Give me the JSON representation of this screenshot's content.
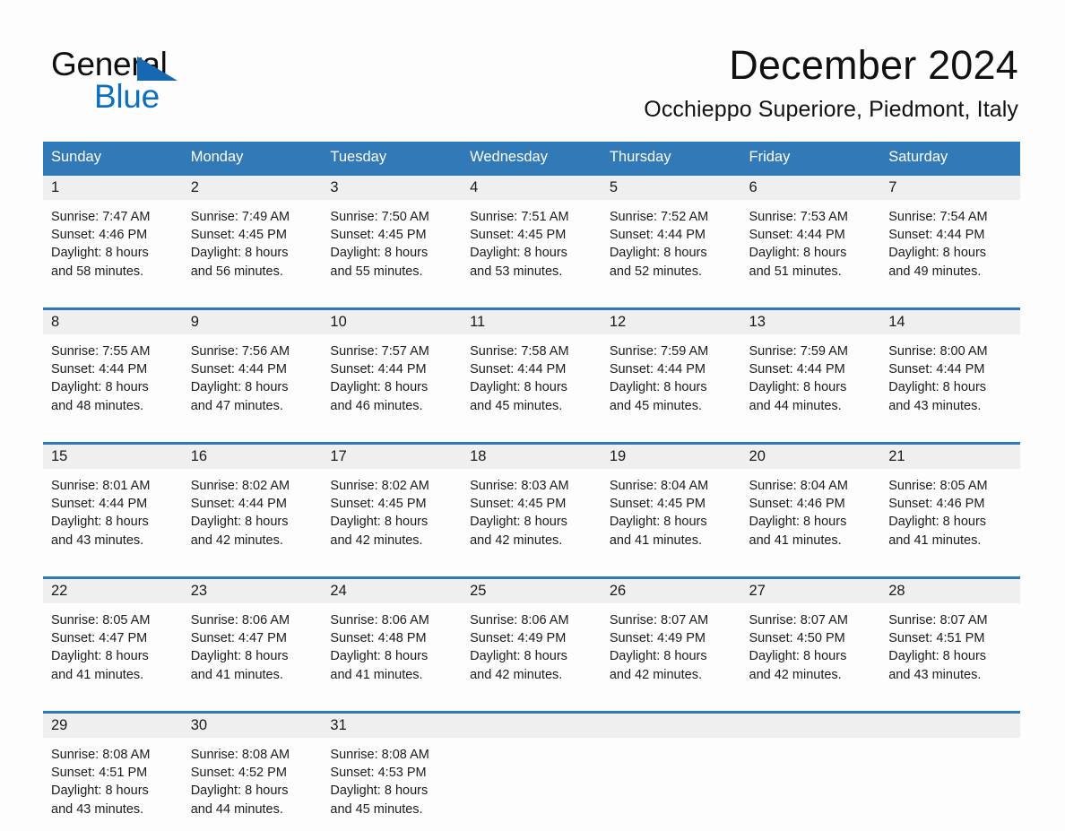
{
  "brand": {
    "name_part1": "General",
    "name_part2": "Blue",
    "logo_icon": "triangle-flag-icon"
  },
  "header": {
    "title": "December 2024",
    "location": "Occhieppo Superiore, Piedmont, Italy"
  },
  "colors": {
    "header_blue": "#3279b7",
    "row_rule_blue": "#2f79b8",
    "daynum_band": "#efefef",
    "brand_blue": "#0d6fc0",
    "page_background": "#fdfdfd"
  },
  "calendar": {
    "weekday_headers": [
      "Sunday",
      "Monday",
      "Tuesday",
      "Wednesday",
      "Thursday",
      "Friday",
      "Saturday"
    ],
    "weeks": [
      [
        {
          "day": "1",
          "sunrise": "Sunrise: 7:47 AM",
          "sunset": "Sunset: 4:46 PM",
          "daylight_line1": "Daylight: 8 hours",
          "daylight_line2": "and 58 minutes."
        },
        {
          "day": "2",
          "sunrise": "Sunrise: 7:49 AM",
          "sunset": "Sunset: 4:45 PM",
          "daylight_line1": "Daylight: 8 hours",
          "daylight_line2": "and 56 minutes."
        },
        {
          "day": "3",
          "sunrise": "Sunrise: 7:50 AM",
          "sunset": "Sunset: 4:45 PM",
          "daylight_line1": "Daylight: 8 hours",
          "daylight_line2": "and 55 minutes."
        },
        {
          "day": "4",
          "sunrise": "Sunrise: 7:51 AM",
          "sunset": "Sunset: 4:45 PM",
          "daylight_line1": "Daylight: 8 hours",
          "daylight_line2": "and 53 minutes."
        },
        {
          "day": "5",
          "sunrise": "Sunrise: 7:52 AM",
          "sunset": "Sunset: 4:44 PM",
          "daylight_line1": "Daylight: 8 hours",
          "daylight_line2": "and 52 minutes."
        },
        {
          "day": "6",
          "sunrise": "Sunrise: 7:53 AM",
          "sunset": "Sunset: 4:44 PM",
          "daylight_line1": "Daylight: 8 hours",
          "daylight_line2": "and 51 minutes."
        },
        {
          "day": "7",
          "sunrise": "Sunrise: 7:54 AM",
          "sunset": "Sunset: 4:44 PM",
          "daylight_line1": "Daylight: 8 hours",
          "daylight_line2": "and 49 minutes."
        }
      ],
      [
        {
          "day": "8",
          "sunrise": "Sunrise: 7:55 AM",
          "sunset": "Sunset: 4:44 PM",
          "daylight_line1": "Daylight: 8 hours",
          "daylight_line2": "and 48 minutes."
        },
        {
          "day": "9",
          "sunrise": "Sunrise: 7:56 AM",
          "sunset": "Sunset: 4:44 PM",
          "daylight_line1": "Daylight: 8 hours",
          "daylight_line2": "and 47 minutes."
        },
        {
          "day": "10",
          "sunrise": "Sunrise: 7:57 AM",
          "sunset": "Sunset: 4:44 PM",
          "daylight_line1": "Daylight: 8 hours",
          "daylight_line2": "and 46 minutes."
        },
        {
          "day": "11",
          "sunrise": "Sunrise: 7:58 AM",
          "sunset": "Sunset: 4:44 PM",
          "daylight_line1": "Daylight: 8 hours",
          "daylight_line2": "and 45 minutes."
        },
        {
          "day": "12",
          "sunrise": "Sunrise: 7:59 AM",
          "sunset": "Sunset: 4:44 PM",
          "daylight_line1": "Daylight: 8 hours",
          "daylight_line2": "and 45 minutes."
        },
        {
          "day": "13",
          "sunrise": "Sunrise: 7:59 AM",
          "sunset": "Sunset: 4:44 PM",
          "daylight_line1": "Daylight: 8 hours",
          "daylight_line2": "and 44 minutes."
        },
        {
          "day": "14",
          "sunrise": "Sunrise: 8:00 AM",
          "sunset": "Sunset: 4:44 PM",
          "daylight_line1": "Daylight: 8 hours",
          "daylight_line2": "and 43 minutes."
        }
      ],
      [
        {
          "day": "15",
          "sunrise": "Sunrise: 8:01 AM",
          "sunset": "Sunset: 4:44 PM",
          "daylight_line1": "Daylight: 8 hours",
          "daylight_line2": "and 43 minutes."
        },
        {
          "day": "16",
          "sunrise": "Sunrise: 8:02 AM",
          "sunset": "Sunset: 4:44 PM",
          "daylight_line1": "Daylight: 8 hours",
          "daylight_line2": "and 42 minutes."
        },
        {
          "day": "17",
          "sunrise": "Sunrise: 8:02 AM",
          "sunset": "Sunset: 4:45 PM",
          "daylight_line1": "Daylight: 8 hours",
          "daylight_line2": "and 42 minutes."
        },
        {
          "day": "18",
          "sunrise": "Sunrise: 8:03 AM",
          "sunset": "Sunset: 4:45 PM",
          "daylight_line1": "Daylight: 8 hours",
          "daylight_line2": "and 42 minutes."
        },
        {
          "day": "19",
          "sunrise": "Sunrise: 8:04 AM",
          "sunset": "Sunset: 4:45 PM",
          "daylight_line1": "Daylight: 8 hours",
          "daylight_line2": "and 41 minutes."
        },
        {
          "day": "20",
          "sunrise": "Sunrise: 8:04 AM",
          "sunset": "Sunset: 4:46 PM",
          "daylight_line1": "Daylight: 8 hours",
          "daylight_line2": "and 41 minutes."
        },
        {
          "day": "21",
          "sunrise": "Sunrise: 8:05 AM",
          "sunset": "Sunset: 4:46 PM",
          "daylight_line1": "Daylight: 8 hours",
          "daylight_line2": "and 41 minutes."
        }
      ],
      [
        {
          "day": "22",
          "sunrise": "Sunrise: 8:05 AM",
          "sunset": "Sunset: 4:47 PM",
          "daylight_line1": "Daylight: 8 hours",
          "daylight_line2": "and 41 minutes."
        },
        {
          "day": "23",
          "sunrise": "Sunrise: 8:06 AM",
          "sunset": "Sunset: 4:47 PM",
          "daylight_line1": "Daylight: 8 hours",
          "daylight_line2": "and 41 minutes."
        },
        {
          "day": "24",
          "sunrise": "Sunrise: 8:06 AM",
          "sunset": "Sunset: 4:48 PM",
          "daylight_line1": "Daylight: 8 hours",
          "daylight_line2": "and 41 minutes."
        },
        {
          "day": "25",
          "sunrise": "Sunrise: 8:06 AM",
          "sunset": "Sunset: 4:49 PM",
          "daylight_line1": "Daylight: 8 hours",
          "daylight_line2": "and 42 minutes."
        },
        {
          "day": "26",
          "sunrise": "Sunrise: 8:07 AM",
          "sunset": "Sunset: 4:49 PM",
          "daylight_line1": "Daylight: 8 hours",
          "daylight_line2": "and 42 minutes."
        },
        {
          "day": "27",
          "sunrise": "Sunrise: 8:07 AM",
          "sunset": "Sunset: 4:50 PM",
          "daylight_line1": "Daylight: 8 hours",
          "daylight_line2": "and 42 minutes."
        },
        {
          "day": "28",
          "sunrise": "Sunrise: 8:07 AM",
          "sunset": "Sunset: 4:51 PM",
          "daylight_line1": "Daylight: 8 hours",
          "daylight_line2": "and 43 minutes."
        }
      ],
      [
        {
          "day": "29",
          "sunrise": "Sunrise: 8:08 AM",
          "sunset": "Sunset: 4:51 PM",
          "daylight_line1": "Daylight: 8 hours",
          "daylight_line2": "and 43 minutes."
        },
        {
          "day": "30",
          "sunrise": "Sunrise: 8:08 AM",
          "sunset": "Sunset: 4:52 PM",
          "daylight_line1": "Daylight: 8 hours",
          "daylight_line2": "and 44 minutes."
        },
        {
          "day": "31",
          "sunrise": "Sunrise: 8:08 AM",
          "sunset": "Sunset: 4:53 PM",
          "daylight_line1": "Daylight: 8 hours",
          "daylight_line2": "and 45 minutes."
        },
        {
          "day": "",
          "sunrise": "",
          "sunset": "",
          "daylight_line1": "",
          "daylight_line2": ""
        },
        {
          "day": "",
          "sunrise": "",
          "sunset": "",
          "daylight_line1": "",
          "daylight_line2": ""
        },
        {
          "day": "",
          "sunrise": "",
          "sunset": "",
          "daylight_line1": "",
          "daylight_line2": ""
        },
        {
          "day": "",
          "sunrise": "",
          "sunset": "",
          "daylight_line1": "",
          "daylight_line2": ""
        }
      ]
    ]
  }
}
